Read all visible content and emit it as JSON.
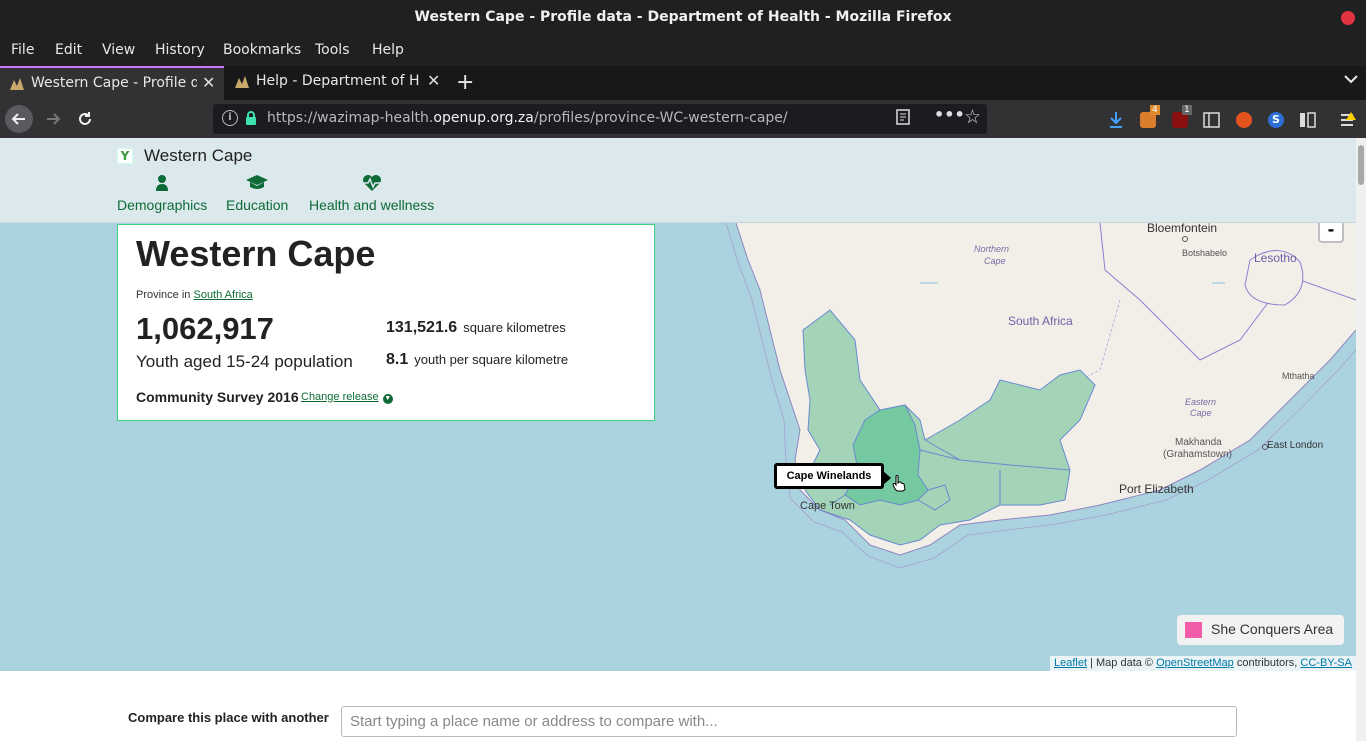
{
  "window": {
    "title": "Western Cape - Profile data - Department of Health - Mozilla Firefox"
  },
  "menu": [
    "File",
    "Edit",
    "View",
    "History",
    "Bookmarks",
    "Tools",
    "Help"
  ],
  "tabs": [
    {
      "label": "Western Cape - Profile da",
      "active": true
    },
    {
      "label": "Help - Department of Hea",
      "active": false
    }
  ],
  "urlbar": {
    "url_prefix": "https://wazimap-health.",
    "url_domain": "openup.org.za",
    "url_path": "/profiles/province-WC-western-cape/"
  },
  "toolbar": {
    "badge_addon": "4",
    "badge_ublock": "1"
  },
  "header": {
    "logo_text": "Y",
    "place": "Western Cape",
    "nav": [
      {
        "label": "Demographics",
        "icon": "person-icon"
      },
      {
        "label": "Education",
        "icon": "graduation-cap-icon"
      },
      {
        "label": "Health and wellness",
        "icon": "heartbeat-icon"
      }
    ]
  },
  "profile": {
    "title": "Western Cape",
    "province_prefix": "Province in",
    "country_link": "South Africa",
    "population_value": "1,062,917",
    "population_label": "Youth aged 15-24 population",
    "area_value": "131,521.6",
    "area_unit": "square kilometres",
    "density_value": "8.1",
    "density_unit": "youth per square kilometre",
    "survey": "Community Survey 2016",
    "change_release": "Change release"
  },
  "map": {
    "zoom_out": "-",
    "tooltip": "Cape Winelands",
    "legend_label": "She Conquers Area",
    "legend_color": "#f25ba8",
    "region_fill": "#a3d4b8",
    "highlight_fill": "#74c9a0",
    "labels": {
      "bloemfontein": "Bloemfontein",
      "botshabelo": "Botshabelo",
      "lesotho": "Lesotho",
      "northern_cape_1": "Northern",
      "northern_cape_2": "Cape",
      "south_africa": "South Africa",
      "mthatha": "Mthatha",
      "eastern_cape_1": "Eastern",
      "eastern_cape_2": "Cape",
      "makhanda_1": "Makhanda",
      "makhanda_2": "(Grahamstown)",
      "east_london": "East London",
      "port_elizabeth": "Port Elizabeth",
      "cape_town": "Cape Town"
    },
    "attribution": {
      "leaflet": "Leaflet",
      "mapdata": "| Map data ©",
      "osm": "OpenStreetMap",
      "contrib": "contributors,",
      "license": "CC-BY-SA"
    }
  },
  "compare": {
    "label": "Compare this place with another",
    "placeholder": "Start typing a place name or address to compare with..."
  }
}
